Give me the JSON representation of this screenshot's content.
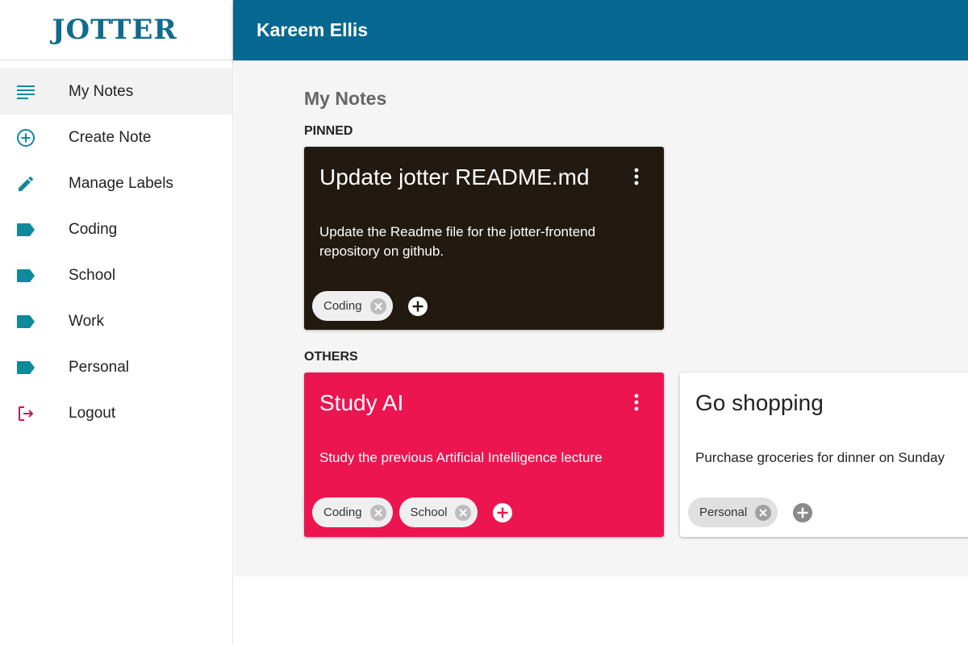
{
  "app": {
    "logo": "JOTTER"
  },
  "header": {
    "user_name": "Kareem Ellis"
  },
  "sidebar": {
    "items": [
      {
        "label": "My Notes",
        "icon": "notes-list-icon",
        "active": true
      },
      {
        "label": "Create Note",
        "icon": "add-circle-icon"
      },
      {
        "label": "Manage Labels",
        "icon": "pencil-icon"
      },
      {
        "label": "Coding",
        "icon": "label-icon"
      },
      {
        "label": "School",
        "icon": "label-icon"
      },
      {
        "label": "Work",
        "icon": "label-icon"
      },
      {
        "label": "Personal",
        "icon": "label-icon"
      },
      {
        "label": "Logout",
        "icon": "logout-icon"
      }
    ]
  },
  "main": {
    "title": "My Notes",
    "pinned_label": "PINNED",
    "others_label": "OTHERS",
    "pinned": [
      {
        "title": "Update jotter README.md",
        "body": "Update the Readme file for the jotter-frontend repository on github.",
        "labels": [
          "Coding"
        ],
        "color": "#221a10"
      }
    ],
    "others": [
      {
        "title": "Study AI",
        "body": "Study the previous Artificial Intelligence lecture",
        "labels": [
          "Coding",
          "School"
        ],
        "color": "#ec1550"
      },
      {
        "title": "Go shopping",
        "body": "Purchase groceries for dinner on Sunday",
        "labels": [
          "Personal"
        ],
        "color": "#ffffff"
      }
    ]
  },
  "colors": {
    "header": "#066890",
    "accent": "#0f8a9c",
    "logout": "#c2185b"
  }
}
